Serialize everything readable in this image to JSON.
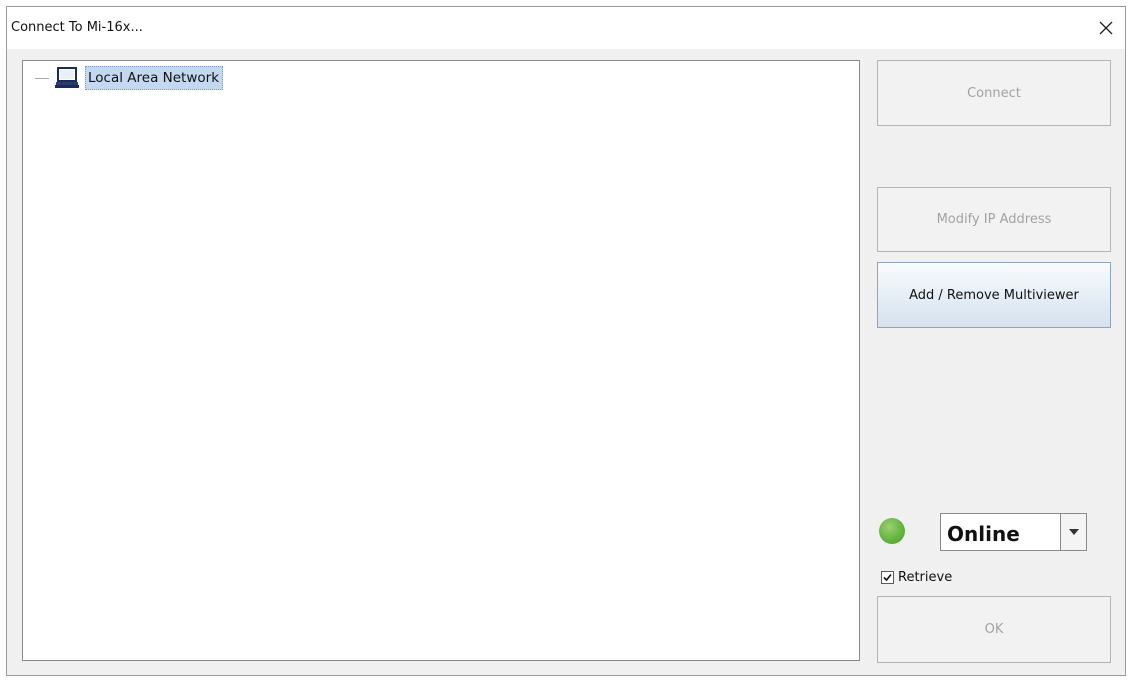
{
  "window": {
    "title": "Connect To Mi-16x...",
    "close_label": "✕"
  },
  "tree": {
    "root": {
      "icon": "computer-icon",
      "label": "Local Area Network"
    }
  },
  "buttons": {
    "connect": "Connect",
    "modify_ip": "Modify IP Address",
    "add_remove": "Add / Remove Multiviewer",
    "ok": "OK"
  },
  "status": {
    "indicator_color": "#66b440",
    "selected": "Online"
  },
  "retrieve": {
    "label": "Retrieve",
    "checked": true
  }
}
